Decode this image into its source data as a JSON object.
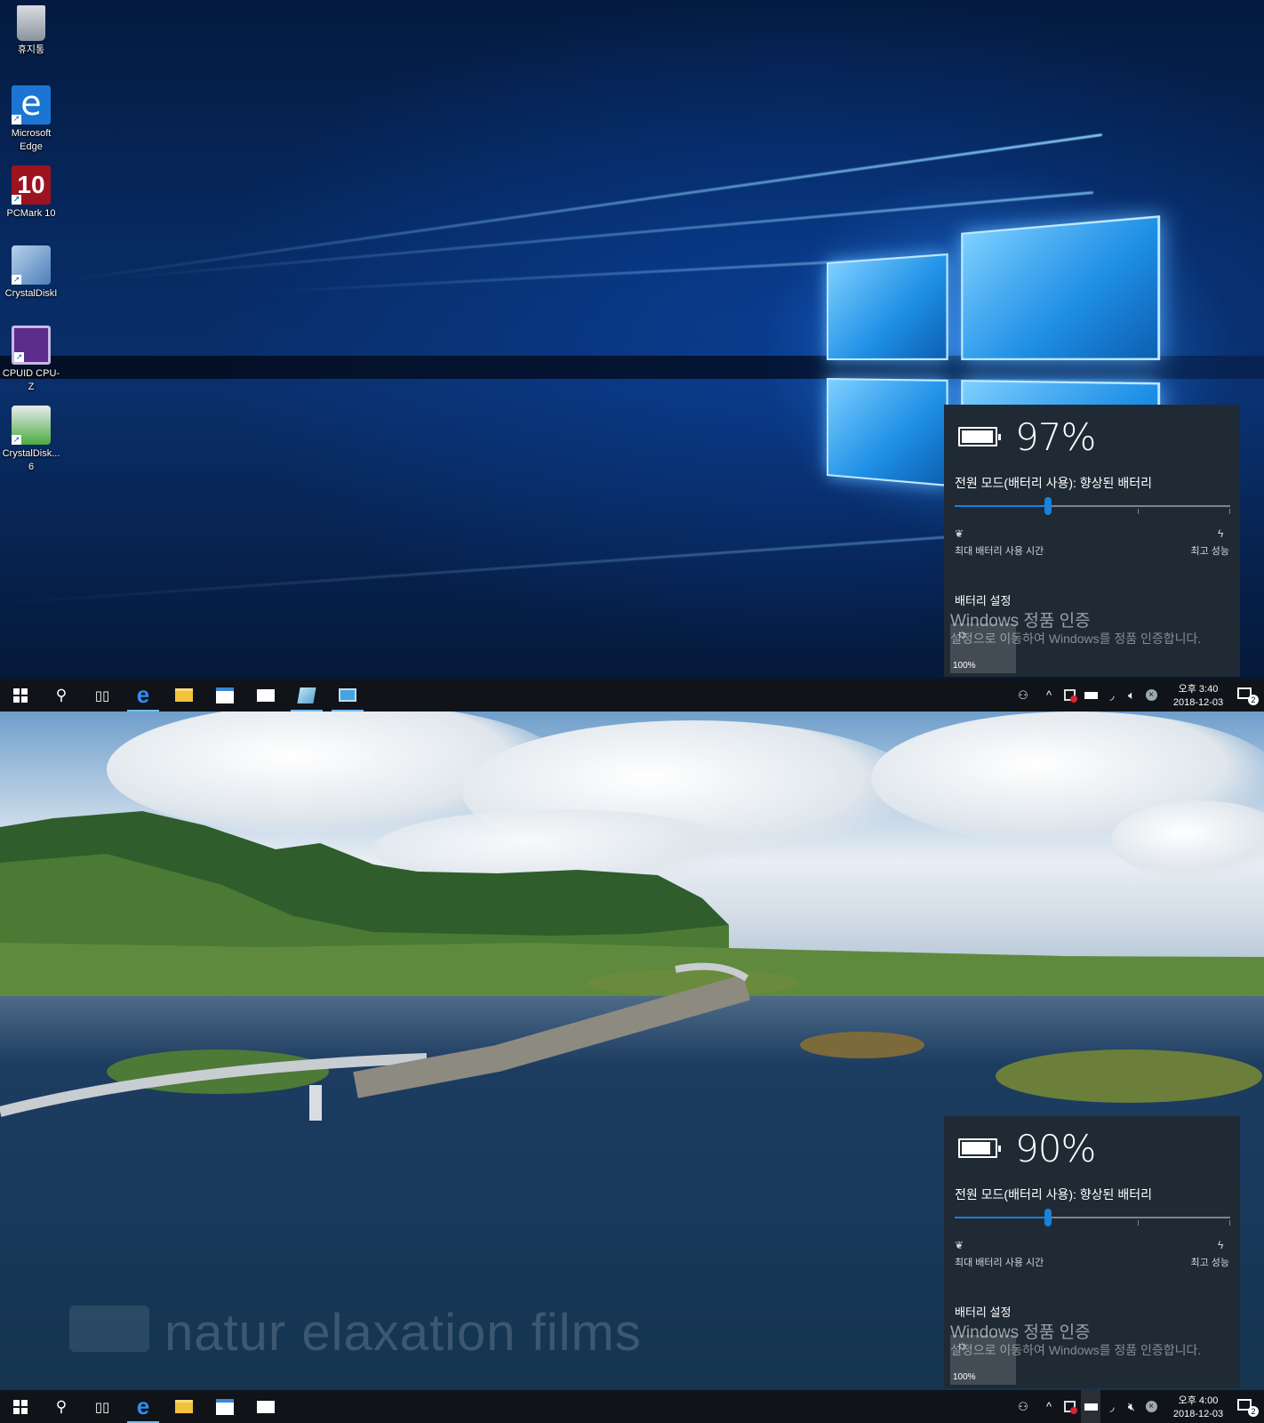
{
  "desktop_icons": [
    {
      "label": "휴지통",
      "icon": "recycle-bin-icon"
    },
    {
      "label": "Microsoft Edge",
      "icon": "edge-icon"
    },
    {
      "label": "PCMark 10",
      "icon": "pcmark-icon"
    },
    {
      "label": "CrystalDiskI",
      "icon": "crystaldiskinfo-icon"
    },
    {
      "label": "CPUID CPU-Z",
      "icon": "cpuz-icon"
    },
    {
      "label": "CrystalDisk... 6",
      "icon": "crystaldiskmark-icon"
    }
  ],
  "top": {
    "battery": {
      "percent_text": "97%",
      "percent_value": 97,
      "power_mode": "전원 모드(배터리 사용): 향상된 배터리",
      "slider_level": 0.34,
      "slider_left_label": "최대 배터리 사용 시간",
      "slider_right_label": "최고 성능",
      "settings_link": "배터리 설정",
      "brightness": "100%"
    },
    "clock": {
      "time": "오후 3:40",
      "date": "2018-12-03"
    },
    "notification_count": "2"
  },
  "bottom": {
    "battery": {
      "percent_text": "90%",
      "percent_value": 90,
      "power_mode": "전원 모드(배터리 사용): 향상된 배터리",
      "slider_level": 0.34,
      "slider_left_label": "최대 배터리 사용 시간",
      "slider_right_label": "최고 성능",
      "settings_link": "배터리 설정",
      "brightness": "100%"
    },
    "clock": {
      "time": "오후 4:00",
      "date": "2018-12-03"
    },
    "notification_count": "2",
    "video_watermark": "natur elaxation films"
  },
  "activation": {
    "title": "Windows 정품 인증",
    "subtitle": "설정으로 이동하여 Windows를 정품 인증합니다."
  },
  "colors": {
    "accent": "#1a82d8",
    "flyout_bg": "#202a35",
    "taskbar_bg": "#101318"
  }
}
